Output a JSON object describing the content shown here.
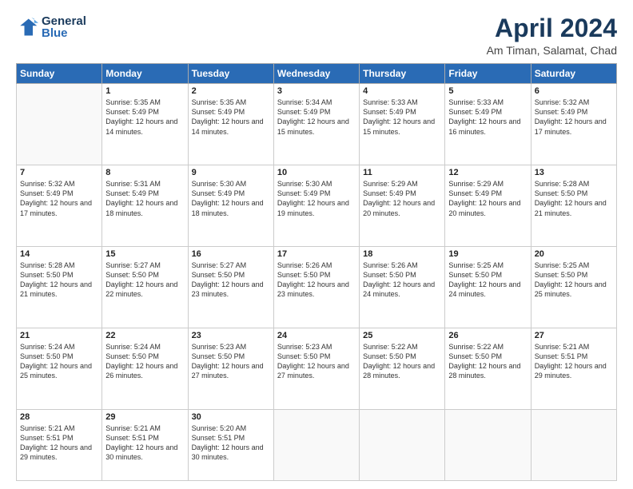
{
  "logo": {
    "line1": "General",
    "line2": "Blue"
  },
  "title": "April 2024",
  "subtitle": "Am Timan, Salamat, Chad",
  "weekdays": [
    "Sunday",
    "Monday",
    "Tuesday",
    "Wednesday",
    "Thursday",
    "Friday",
    "Saturday"
  ],
  "weeks": [
    [
      {
        "day": "",
        "sunrise": "",
        "sunset": "",
        "daylight": ""
      },
      {
        "day": "1",
        "sunrise": "Sunrise: 5:35 AM",
        "sunset": "Sunset: 5:49 PM",
        "daylight": "Daylight: 12 hours and 14 minutes."
      },
      {
        "day": "2",
        "sunrise": "Sunrise: 5:35 AM",
        "sunset": "Sunset: 5:49 PM",
        "daylight": "Daylight: 12 hours and 14 minutes."
      },
      {
        "day": "3",
        "sunrise": "Sunrise: 5:34 AM",
        "sunset": "Sunset: 5:49 PM",
        "daylight": "Daylight: 12 hours and 15 minutes."
      },
      {
        "day": "4",
        "sunrise": "Sunrise: 5:33 AM",
        "sunset": "Sunset: 5:49 PM",
        "daylight": "Daylight: 12 hours and 15 minutes."
      },
      {
        "day": "5",
        "sunrise": "Sunrise: 5:33 AM",
        "sunset": "Sunset: 5:49 PM",
        "daylight": "Daylight: 12 hours and 16 minutes."
      },
      {
        "day": "6",
        "sunrise": "Sunrise: 5:32 AM",
        "sunset": "Sunset: 5:49 PM",
        "daylight": "Daylight: 12 hours and 17 minutes."
      }
    ],
    [
      {
        "day": "7",
        "sunrise": "Sunrise: 5:32 AM",
        "sunset": "Sunset: 5:49 PM",
        "daylight": "Daylight: 12 hours and 17 minutes."
      },
      {
        "day": "8",
        "sunrise": "Sunrise: 5:31 AM",
        "sunset": "Sunset: 5:49 PM",
        "daylight": "Daylight: 12 hours and 18 minutes."
      },
      {
        "day": "9",
        "sunrise": "Sunrise: 5:30 AM",
        "sunset": "Sunset: 5:49 PM",
        "daylight": "Daylight: 12 hours and 18 minutes."
      },
      {
        "day": "10",
        "sunrise": "Sunrise: 5:30 AM",
        "sunset": "Sunset: 5:49 PM",
        "daylight": "Daylight: 12 hours and 19 minutes."
      },
      {
        "day": "11",
        "sunrise": "Sunrise: 5:29 AM",
        "sunset": "Sunset: 5:49 PM",
        "daylight": "Daylight: 12 hours and 20 minutes."
      },
      {
        "day": "12",
        "sunrise": "Sunrise: 5:29 AM",
        "sunset": "Sunset: 5:49 PM",
        "daylight": "Daylight: 12 hours and 20 minutes."
      },
      {
        "day": "13",
        "sunrise": "Sunrise: 5:28 AM",
        "sunset": "Sunset: 5:50 PM",
        "daylight": "Daylight: 12 hours and 21 minutes."
      }
    ],
    [
      {
        "day": "14",
        "sunrise": "Sunrise: 5:28 AM",
        "sunset": "Sunset: 5:50 PM",
        "daylight": "Daylight: 12 hours and 21 minutes."
      },
      {
        "day": "15",
        "sunrise": "Sunrise: 5:27 AM",
        "sunset": "Sunset: 5:50 PM",
        "daylight": "Daylight: 12 hours and 22 minutes."
      },
      {
        "day": "16",
        "sunrise": "Sunrise: 5:27 AM",
        "sunset": "Sunset: 5:50 PM",
        "daylight": "Daylight: 12 hours and 23 minutes."
      },
      {
        "day": "17",
        "sunrise": "Sunrise: 5:26 AM",
        "sunset": "Sunset: 5:50 PM",
        "daylight": "Daylight: 12 hours and 23 minutes."
      },
      {
        "day": "18",
        "sunrise": "Sunrise: 5:26 AM",
        "sunset": "Sunset: 5:50 PM",
        "daylight": "Daylight: 12 hours and 24 minutes."
      },
      {
        "day": "19",
        "sunrise": "Sunrise: 5:25 AM",
        "sunset": "Sunset: 5:50 PM",
        "daylight": "Daylight: 12 hours and 24 minutes."
      },
      {
        "day": "20",
        "sunrise": "Sunrise: 5:25 AM",
        "sunset": "Sunset: 5:50 PM",
        "daylight": "Daylight: 12 hours and 25 minutes."
      }
    ],
    [
      {
        "day": "21",
        "sunrise": "Sunrise: 5:24 AM",
        "sunset": "Sunset: 5:50 PM",
        "daylight": "Daylight: 12 hours and 25 minutes."
      },
      {
        "day": "22",
        "sunrise": "Sunrise: 5:24 AM",
        "sunset": "Sunset: 5:50 PM",
        "daylight": "Daylight: 12 hours and 26 minutes."
      },
      {
        "day": "23",
        "sunrise": "Sunrise: 5:23 AM",
        "sunset": "Sunset: 5:50 PM",
        "daylight": "Daylight: 12 hours and 27 minutes."
      },
      {
        "day": "24",
        "sunrise": "Sunrise: 5:23 AM",
        "sunset": "Sunset: 5:50 PM",
        "daylight": "Daylight: 12 hours and 27 minutes."
      },
      {
        "day": "25",
        "sunrise": "Sunrise: 5:22 AM",
        "sunset": "Sunset: 5:50 PM",
        "daylight": "Daylight: 12 hours and 28 minutes."
      },
      {
        "day": "26",
        "sunrise": "Sunrise: 5:22 AM",
        "sunset": "Sunset: 5:50 PM",
        "daylight": "Daylight: 12 hours and 28 minutes."
      },
      {
        "day": "27",
        "sunrise": "Sunrise: 5:21 AM",
        "sunset": "Sunset: 5:51 PM",
        "daylight": "Daylight: 12 hours and 29 minutes."
      }
    ],
    [
      {
        "day": "28",
        "sunrise": "Sunrise: 5:21 AM",
        "sunset": "Sunset: 5:51 PM",
        "daylight": "Daylight: 12 hours and 29 minutes."
      },
      {
        "day": "29",
        "sunrise": "Sunrise: 5:21 AM",
        "sunset": "Sunset: 5:51 PM",
        "daylight": "Daylight: 12 hours and 30 minutes."
      },
      {
        "day": "30",
        "sunrise": "Sunrise: 5:20 AM",
        "sunset": "Sunset: 5:51 PM",
        "daylight": "Daylight: 12 hours and 30 minutes."
      },
      {
        "day": "",
        "sunrise": "",
        "sunset": "",
        "daylight": ""
      },
      {
        "day": "",
        "sunrise": "",
        "sunset": "",
        "daylight": ""
      },
      {
        "day": "",
        "sunrise": "",
        "sunset": "",
        "daylight": ""
      },
      {
        "day": "",
        "sunrise": "",
        "sunset": "",
        "daylight": ""
      }
    ]
  ]
}
